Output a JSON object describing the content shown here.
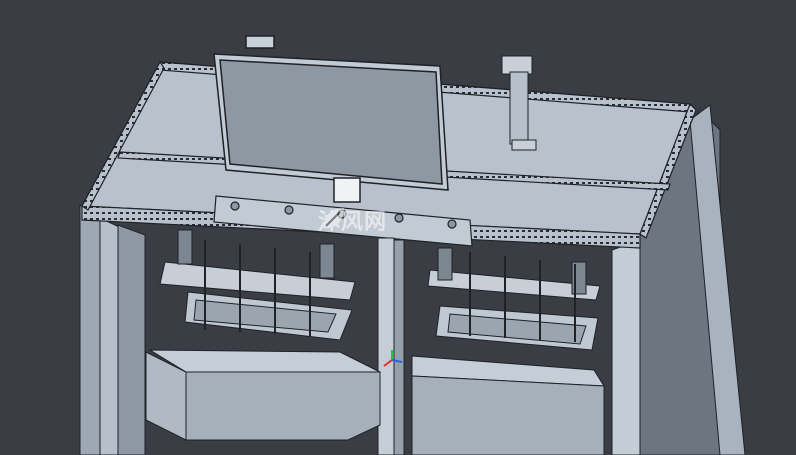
{
  "scene": {
    "description_label": "",
    "background_color": "#3a3d44",
    "model_color": "#a9b3bf",
    "edge_color": "#1f2227"
  },
  "watermark": {
    "text": "沐风网",
    "icon": "leaf-logo-icon"
  }
}
